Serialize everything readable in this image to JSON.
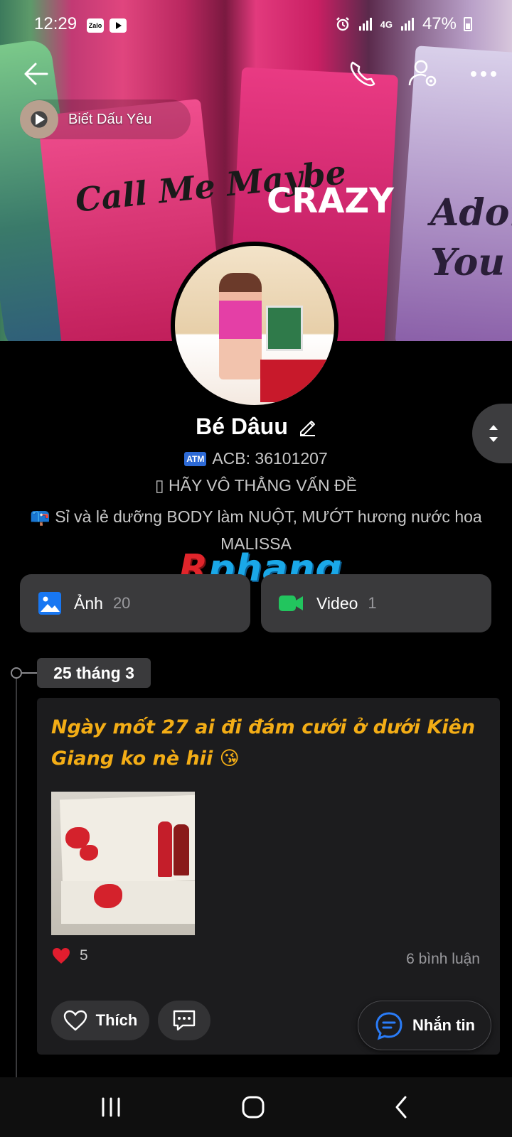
{
  "status_bar": {
    "time": "12:29",
    "app_icons": [
      "zalo-icon",
      "youtube-icon"
    ],
    "zalo_label": "Zalo",
    "network": "4G",
    "battery": "47%"
  },
  "header": {
    "music_title": "Biết Dấu Yêu",
    "cover_texts": {
      "left": "Call Me Maybe",
      "middle": "CRAZY",
      "right": "Adore You"
    }
  },
  "profile": {
    "name": "Bé Dâuu",
    "bio_line1": "ACB: 36101207",
    "atm_badge": "ATM",
    "bio_line2": "▯ HÃY VÔ THẲNG VẤN ĐỀ",
    "bio_line3": "📪 Sỉ và lẻ dưỡng BODY làm NUỘT, MƯỚT hương nước hoa MALISSA"
  },
  "watermark": {
    "first_letter": "R",
    "rest": "phang"
  },
  "media": {
    "photo_label": "Ảnh",
    "photo_count": "20",
    "video_label": "Video",
    "video_count": "1"
  },
  "timeline": {
    "date": "25 tháng 3"
  },
  "post": {
    "text": "Ngày mốt 27 ai đi đám cưới ở dưới Kiên Giang ko nè hii 😘",
    "reaction_count": "5",
    "comments": "6 bình luận",
    "like_label": "Thích"
  },
  "message_button": {
    "label": "Nhắn tin"
  },
  "colors": {
    "accent_blue": "#1877f2",
    "video_green": "#22c55e",
    "post_text": "#f3ad16",
    "heart": "#e11d2e"
  }
}
